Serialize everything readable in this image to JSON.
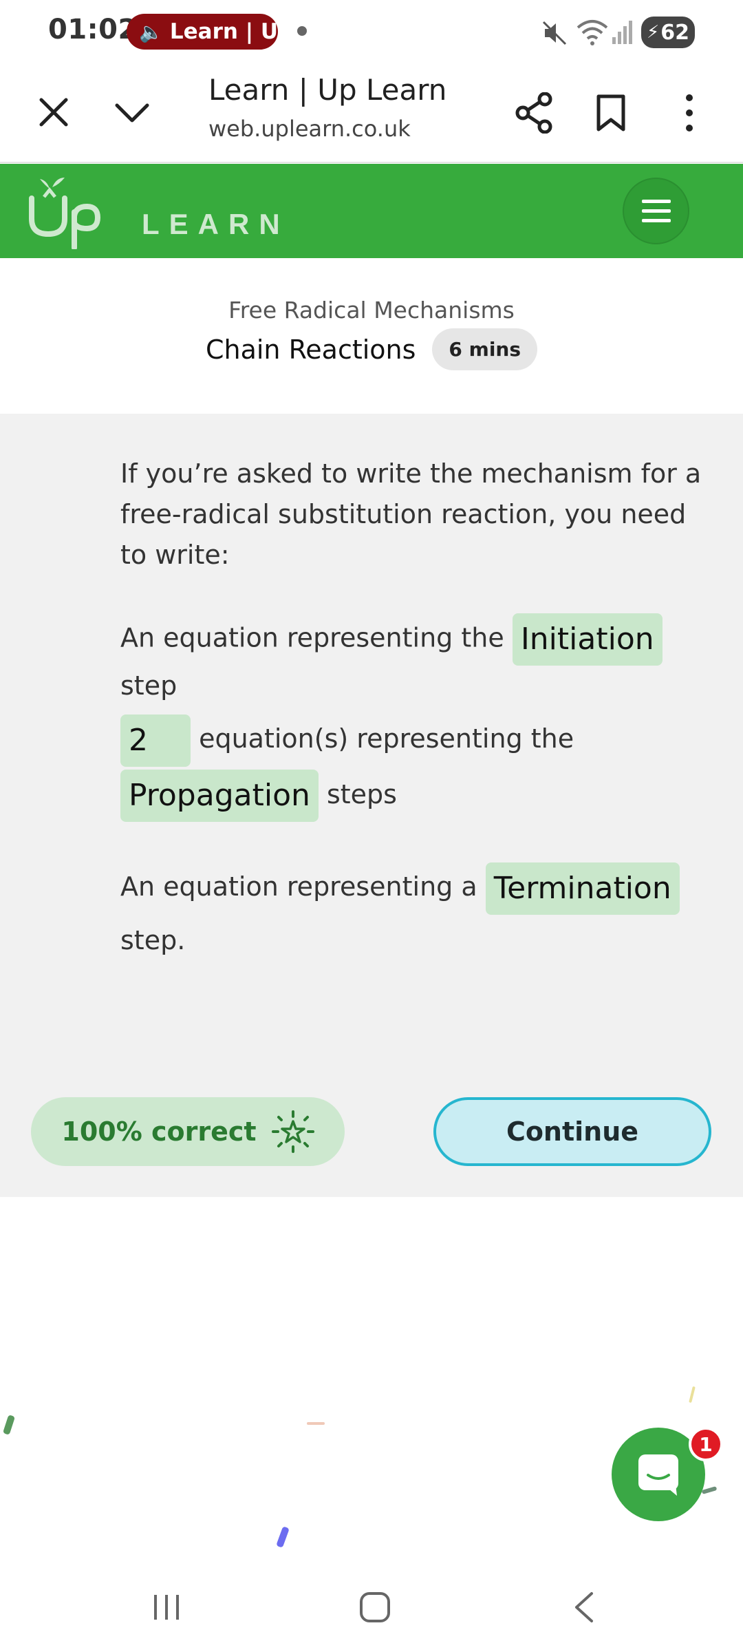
{
  "status_bar": {
    "time": "01:02",
    "media_pill_label": "Learn | Up",
    "battery_level": "62",
    "icons": [
      "speaker-icon",
      "mute-icon",
      "wifi-icon",
      "signal-icon",
      "battery-charging-icon"
    ]
  },
  "browser": {
    "page_title": "Learn | Up Learn",
    "url": "web.uplearn.co.uk",
    "icons": [
      "close-icon",
      "chevron-down-icon",
      "share-icon",
      "bookmark-icon",
      "more-vertical-icon"
    ]
  },
  "site_header": {
    "logo_up": "Up",
    "logo_learn": "LEARN",
    "menu_icon": "hamburger-menu-icon",
    "brand_color": "#37ab3d"
  },
  "lesson": {
    "topic": "Free Radical Mechanisms",
    "title": "Chain Reactions",
    "duration": "6 mins"
  },
  "content": {
    "intro": "If you’re asked to write the mechanism for a free-radical substitution reaction, you need to write:",
    "line1": {
      "before": "An equation representing the",
      "answer": "Initiation",
      "after": "step"
    },
    "line2": {
      "answer_count": "2",
      "middle": "equation(s) representing the",
      "answer": "Propagation",
      "after": "steps"
    },
    "line3": {
      "before": "An equation representing a",
      "answer": "Termination",
      "after": "step."
    }
  },
  "actions": {
    "score_label": "100% correct",
    "score_icon": "star-burst-icon",
    "continue_label": "Continue"
  },
  "chat": {
    "icon": "chat-icon",
    "badge_count": "1"
  },
  "nav_bar": {
    "icons": [
      "recent-apps-icon",
      "home-icon",
      "back-icon"
    ]
  }
}
